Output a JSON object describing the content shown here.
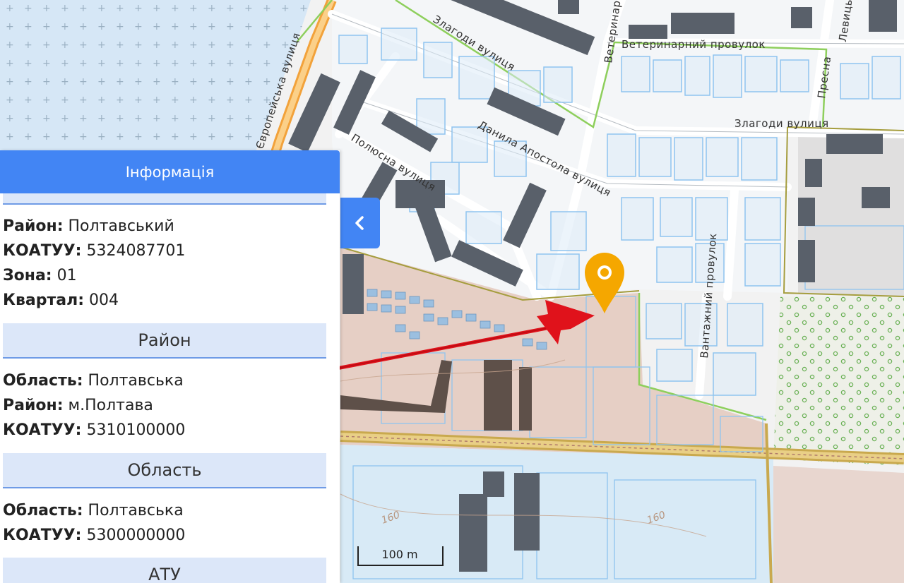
{
  "panel": {
    "title": "Інформація",
    "top_section": {
      "rows": [
        {
          "label": "Район:",
          "value": "Полтавський"
        },
        {
          "label": "КОАТУУ:",
          "value": "5324087701"
        },
        {
          "label": "Зона:",
          "value": "01"
        },
        {
          "label": "Квартал:",
          "value": "004"
        }
      ]
    },
    "district_section": {
      "title": "Район",
      "rows": [
        {
          "label": "Область:",
          "value": "Полтавська"
        },
        {
          "label": "Район:",
          "value": "м.Полтава"
        },
        {
          "label": "КОАТУУ:",
          "value": "5310100000"
        }
      ]
    },
    "region_section": {
      "title": "Область",
      "rows": [
        {
          "label": "Область:",
          "value": "Полтавська"
        },
        {
          "label": "КОАТУУ:",
          "value": "5300000000"
        }
      ]
    },
    "atu_section": {
      "title": "АТУ"
    }
  },
  "map": {
    "streets": {
      "yevropeiska": "Європейська вулиця",
      "vaterynarnyi": "Ветеринарний провулок",
      "veterynarna": "Ветеринарна",
      "zlahody_top": "Злагоди вулиця",
      "zlahody_right": "Злагоди вулиця",
      "danyla_apostola": "Данила Апостола вулиця",
      "poliusna": "Полюсна вулиця",
      "vantazhnyi": "Вантажний провулок",
      "levytskoho": "Левицького",
      "presna": "Пресна"
    },
    "contours": [
      "160",
      "160"
    ],
    "scale_label": "100 m",
    "colors": {
      "water_area": "#d4e6f5",
      "industrial_zone": "#e3cbc0",
      "parcel_outline": "#8fc4ef",
      "building": "#555c63",
      "road_main": "#e8b45a",
      "highway": "#f2a23b",
      "marker": "#f5a700",
      "arrow": "#e0121b",
      "panel_header": "#4285f4",
      "section_bg": "#dce7f9"
    }
  },
  "icons": {
    "collapse": "chevron-left-icon",
    "marker": "location-pin-icon"
  }
}
